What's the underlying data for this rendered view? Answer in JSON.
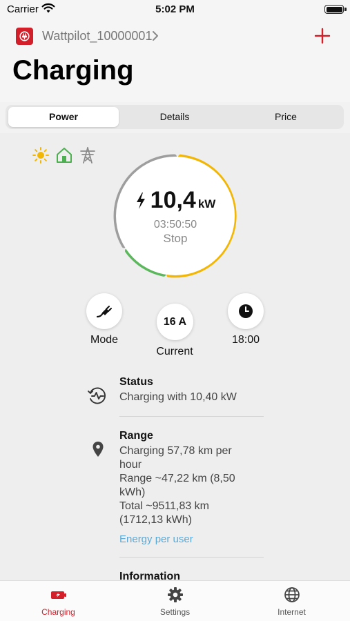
{
  "status_bar": {
    "carrier": "Carrier",
    "time": "5:02 PM"
  },
  "header": {
    "device_name": "Wattpilot_10000001",
    "title": "Charging"
  },
  "tabs": [
    {
      "label": "Power",
      "active": true
    },
    {
      "label": "Details",
      "active": false
    },
    {
      "label": "Price",
      "active": false
    }
  ],
  "energy_sources": [
    {
      "icon": "sun-icon",
      "color": "#f2b705"
    },
    {
      "icon": "home-icon",
      "color": "#4caf50"
    },
    {
      "icon": "power-tower-icon",
      "color": "#8a8a8a"
    }
  ],
  "gauge": {
    "power_value": "10,4",
    "power_unit": "kW",
    "timer": "03:50:50",
    "action": "Stop",
    "colors": {
      "solar": "#f2b705",
      "home": "#5cb85c",
      "grid": "#9e9e9e"
    }
  },
  "controls": {
    "mode_label": "Mode",
    "current_value": "16 A",
    "current_label": "Current",
    "time_label": "18:00"
  },
  "info": {
    "status": {
      "title": "Status",
      "text": "Charging with 10,40 kW"
    },
    "range": {
      "title": "Range",
      "lines": [
        "Charging 57,78 km per hour",
        "Range ~47,22 km (8,50 kWh)",
        "Total ~9511,83 km (1712,13 kWh)"
      ],
      "link": "Energy per user"
    },
    "information_title": "Information"
  },
  "tabbar": [
    {
      "label": "Charging",
      "icon": "charger-icon",
      "active": true
    },
    {
      "label": "Settings",
      "icon": "gear-icon",
      "active": false
    },
    {
      "label": "Internet",
      "icon": "globe-icon",
      "active": false
    }
  ],
  "colors": {
    "accent": "#d31f2a",
    "link": "#5aa9d6"
  }
}
